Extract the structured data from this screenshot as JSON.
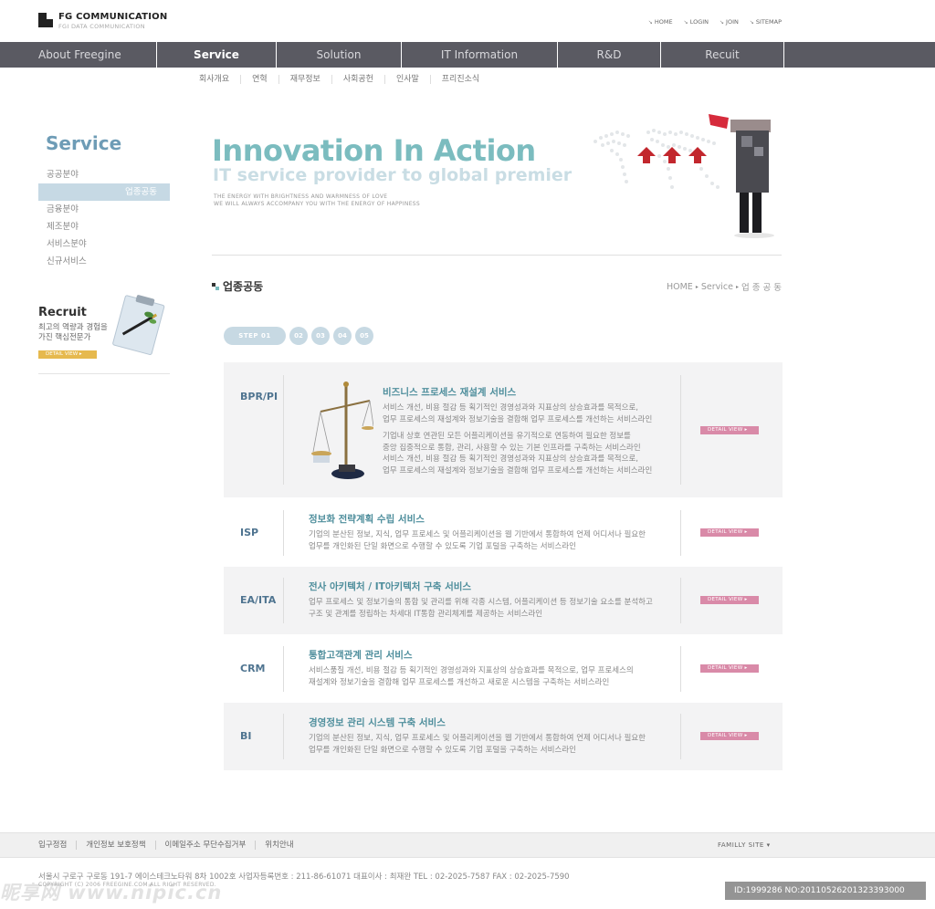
{
  "brand": {
    "title": "FG COMMUNICATION",
    "subtitle": "FGI DATA COMMUNICATION"
  },
  "util_links": [
    "HOME",
    "LOGIN",
    "JOIN",
    "SITEMAP"
  ],
  "gnb": [
    "About Freegine",
    "Service",
    "Solution",
    "IT Information",
    "R&D",
    "Recuit"
  ],
  "subnav": [
    "회사개요",
    "연혁",
    "재무정보",
    "사회공헌",
    "인사말",
    "프리진소식"
  ],
  "sidebar": {
    "title": "Service",
    "items": [
      "공공분야",
      "업종공동",
      "금융분야",
      "제조분야",
      "서비스분야",
      "신규서비스"
    ]
  },
  "recruit": {
    "title": "Recruit",
    "text": "최고의 역량과 경험을 가진 핵심전문가",
    "button": "DETAIL VIEW ▸"
  },
  "hero": {
    "title": "Innovation In Action",
    "subtitle": "IT service provider to global premier",
    "line1": "THE ENERGY WITH BRIGHTNESS AND WARMNESS OF LOVE",
    "line2": "WE WILL ALWAYS ACCOMPANY YOU WITH THE ENERGY OF HAPPINESS"
  },
  "page": {
    "heading": "업종공동",
    "breadcrumb": [
      "HOME",
      "Service",
      "업 종 공 동"
    ]
  },
  "steps": [
    "STEP 01",
    "02",
    "03",
    "04",
    "05"
  ],
  "services": [
    {
      "code": "BPR/PI",
      "title": "비즈니스 프로세스 재설계 서비스",
      "desc1": "서비스 개선, 비용 절감 등 획기적인 경영성과와 지표상의 상승효과를 목적으로,",
      "desc2": "업무 프로세스의 재설계와 정보기술을 결합해 업무 프로세스를 개선하는 서비스라인",
      "desc3": "기업내 상호 연관된 모든 어플리케이션을 유기적으로 연동하여 필요한 정보를",
      "desc4": "중앙 집중적으로 통합, 관리, 사용할 수 있는 기본 인프라를 구축하는 서비스라인",
      "desc5": "서비스 개선, 비용 절감 등 획기적인 경영성과와 지표상의 상승효과를 목적으로,",
      "desc6": "업무 프로세스의 재설계와 정보기술을 결합해 업무 프로세스를 개선하는 서비스라인",
      "button": "DETAIL VIEW ▸"
    },
    {
      "code": "ISP",
      "title": "정보화 전략계획 수립 서비스",
      "desc1": "기업의 분산된 정보, 지식, 업무 프로세스 및 어플리케이션을 웹 기반에서 통합하여 언제 어디서나 필요한",
      "desc2": "업무를 개인화된 단일 화면으로 수행할 수 있도록 기업 포털을 구축하는 서비스라인",
      "button": "DETAIL VIEW ▸"
    },
    {
      "code": "EA/ITA",
      "title": "전사 아키텍처 / IT아키텍처 구축 서비스",
      "desc1": "업무 프로세스 및 정보기술의 통합 및 관리를 위해 각종 시스템, 어플리케이션 등 정보기술 요소를 분석하고",
      "desc2": "구조 및 관계를 정립하는 차세대 IT통합 관리체계를 제공하는 서비스라인",
      "button": "DETAIL VIEW ▸"
    },
    {
      "code": "CRM",
      "title": "통합고객관계 관리 서비스",
      "desc1": "서비스품질 개선, 비용 절감 등 획기적인 경영성과와 지표상의 상승효과를 목적으로, 업무 프로세스의",
      "desc2": "재설계와 정보기술을 결합해 업무 프로세스를 개선하고 새로운 시스템을 구축하는 서비스라인",
      "button": "DETAIL VIEW ▸"
    },
    {
      "code": "BI",
      "title": "경영정보 관리 시스템 구축 서비스",
      "desc1": "기업의 분산된 정보, 지식, 업무 프로세스 및 어플리케이션을 웹 기반에서 통합하여 언제 어디서나 필요한",
      "desc2": "업무를 개인화된 단일 화면으로 수행할 수 있도록 기업 포털을 구축하는 서비스라인",
      "button": "DETAIL VIEW ▸"
    }
  ],
  "footer": {
    "links": [
      "입구정점",
      "개인정보 보호정책",
      "이메일주소 무단수집거부",
      "위치안내"
    ],
    "family_site": "FAMILLY SITE ▾",
    "address": "서울시 구로구 구로동 191-7 에이스테크노타워 8차 1002호  사업자등록번호 : 211-86-61071  대표이사 : 최재완   TEL : 02-2025-7587   FAX : 02-2025-7590",
    "copyright": "COPYRIGHT (C) 2006 FREEGINE.COM ALL RIGHT RESERVED.",
    "watermark": "昵享网 www.nipic.cn",
    "image_id": "ID:1999286 NO:20110526201323393000"
  },
  "colors": {
    "nav_bg": "#5a5a62",
    "accent_teal": "#7bbcbf",
    "side_active": "#c6d9e4",
    "detail_pink": "#d98aa8",
    "recruit_yellow": "#e6b94e"
  }
}
